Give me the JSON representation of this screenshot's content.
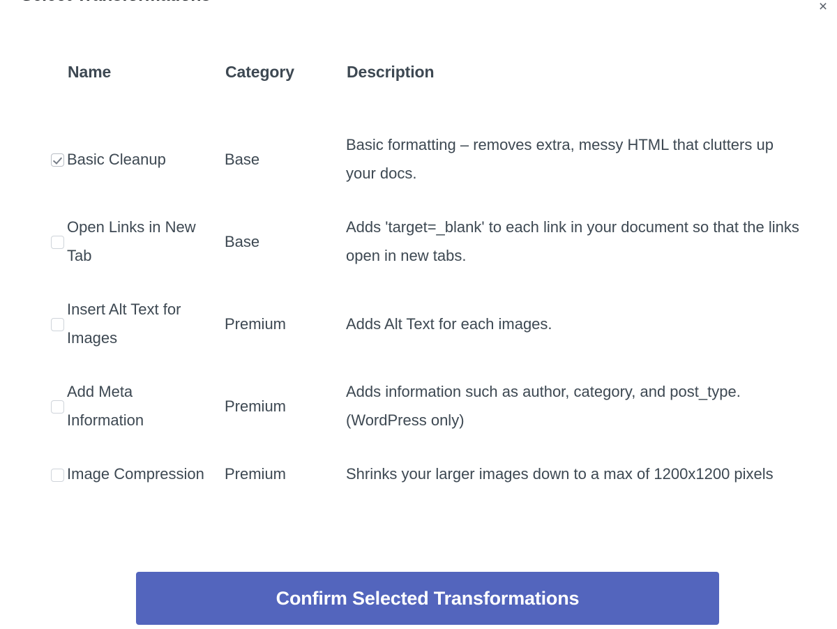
{
  "dialog": {
    "title": "Select Transformations",
    "close_icon": "×"
  },
  "table": {
    "columns": {
      "select": "",
      "name": "Name",
      "category": "Category",
      "description": "Description"
    },
    "rows": [
      {
        "checked": true,
        "name": "Basic Cleanup",
        "category": "Base",
        "description": "Basic formatting – removes extra, messy HTML that clutters up your docs."
      },
      {
        "checked": false,
        "name": "Open Links in New Tab",
        "category": "Base",
        "description": "Adds 'target=_blank' to each link in your document so that the links open in new tabs."
      },
      {
        "checked": false,
        "name": "Insert Alt Text for Images",
        "category": "Premium",
        "description": "Adds Alt Text for each images."
      },
      {
        "checked": false,
        "name": "Add Meta Information",
        "category": "Premium",
        "description": "Adds information such as author, category, and post_type. (WordPress only)"
      },
      {
        "checked": false,
        "name": "Image Compression",
        "category": "Premium",
        "description": "Shrinks your larger images down to a max of 1200x1200 pixels"
      }
    ]
  },
  "footer": {
    "confirm_label": "Confirm Selected Transformations"
  },
  "colors": {
    "accent": "#5365bd",
    "text": "#3d4852",
    "title": "#1b1f23",
    "checkbox_border": "#cfd4da",
    "check_mark": "#757c86"
  }
}
